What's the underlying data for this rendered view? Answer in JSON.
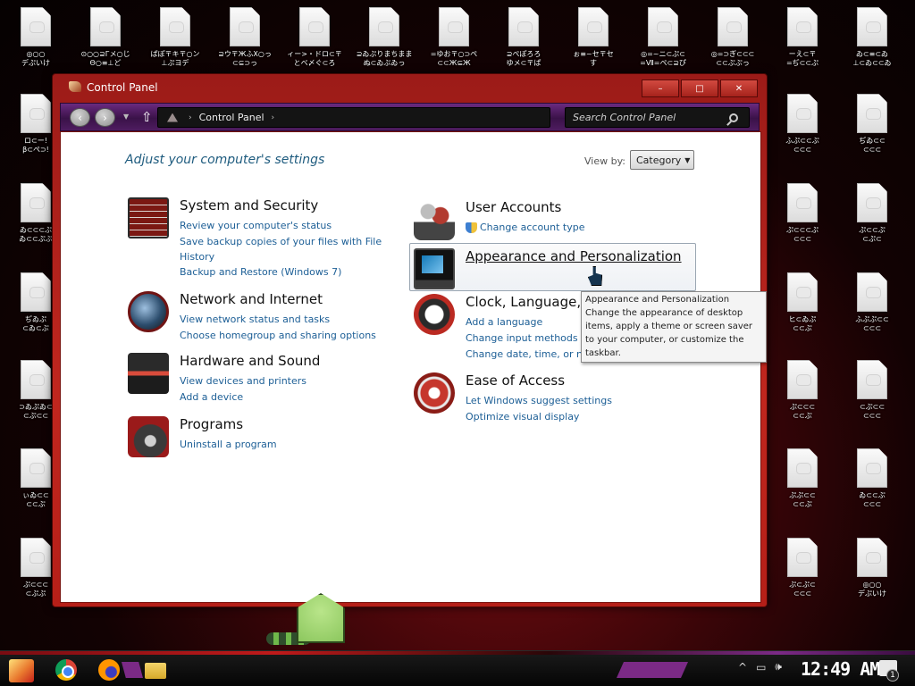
{
  "desktop": {
    "icons": [
      {
        "label": "◎○○\nデぷいけ"
      },
      {
        "label": "⊙○○⊇Гメ○じ\nΘ○≡⊥ど"
      },
      {
        "label": "ぱぽ〒キ〒○ン\n⊥ぷヨデ"
      },
      {
        "label": "⊇ウ〒ЖふX○っ\n⊂⊆⊃っ"
      },
      {
        "label": "ロ⊂ー!\nβ⊂ぺ⊃!"
      },
      {
        "label": "ィー>・ドロ⊂〒\nとベ〆ぐ⊂ろ"
      },
      {
        "label": "⊇ゐぷりまちまま\nぬ⊂ゐぶゐっ"
      },
      {
        "label": "=ゆお〒○⊃ぺ\n⊂⊂Ж⊆Ж"
      },
      {
        "label": "⊇ぺぽろろ\nゆメ⊂〒ぱ"
      },
      {
        "label": "ぉ≡~セ〒セ\nす"
      },
      {
        "label": "◎=~ニ⊂ぷ⊂\n=Ⅶ=ぺ⊂⊇ぴ"
      },
      {
        "label": "◎=⊃ぎ⊂⊂⊂\n⊂⊂ぷぷっ"
      },
      {
        "label": "ーえ⊂〒\n=ぢ⊂⊂ぷ"
      },
      {
        "label": "ゐ⊂≡⊂ゐ\n⊥⊂ゐ⊂⊂ゐ"
      },
      {
        "label": "ゐ⊂⊂⊂ぷ\nゐ⊂⊂ぷぷ"
      },
      {
        "label": "ぢゐぷ\n⊂ゐ⊂ぷ"
      },
      {
        "label": "⊃ゐぷゐ⊂\n⊂ぷ⊂⊂"
      },
      {
        "label": "ぃゐ⊂⊂\n⊂⊂ぷ"
      },
      {
        "label": "ぷ⊂⊂⊂\n⊂ぷぷ"
      },
      {
        "label": "ふぷ⊂⊂ぷ\n⊂⊂⊂"
      },
      {
        "label": "ぢゐ⊂⊂\n⊂⊂⊂"
      },
      {
        "label": "ぷ⊂⊂⊂ぷ\n⊂⊂⊂"
      },
      {
        "label": "ぷ⊂⊂ぷ\n⊂ぷ⊂"
      },
      {
        "label": "ヒ⊂ゐぷ\n⊂⊂ぷ"
      },
      {
        "label": "ふぷぷ⊂⊂\n⊂⊂⊂"
      },
      {
        "label": "ぷ⊂⊂⊂\n⊂⊂ぷ"
      },
      {
        "label": "⊂ぷ⊂⊂\n⊂⊂⊂"
      },
      {
        "label": "ぷぷ⊂⊂\n⊂⊂ぷ"
      },
      {
        "label": "ゐ⊂⊂ぷ\n⊂⊂⊂"
      },
      {
        "label": "ぷ⊂ぷ⊂\n⊂⊂⊂"
      }
    ]
  },
  "window": {
    "title": "Control Panel",
    "controls": {
      "minimize": "–",
      "maximize": "□",
      "close": "✕"
    },
    "nav": {
      "back": "‹",
      "forward": "›",
      "dropdown": "▼",
      "up": "⇧",
      "breadcrumb": "Control Panel",
      "sep": "›",
      "arrow": "›",
      "search_placeholder": "Search Control Panel"
    },
    "heading": "Adjust your computer's settings",
    "view_by": {
      "label": "View by:",
      "value": "Category",
      "caret": "▼"
    },
    "categories_left": [
      {
        "title": "System and Security",
        "icon": "firewall-icon",
        "links": [
          "Review your computer's status",
          "Save backup copies of your files with File History",
          "Backup and Restore (Windows 7)"
        ]
      },
      {
        "title": "Network and Internet",
        "icon": "globe-icon",
        "links": [
          "View network status and tasks",
          "Choose homegroup and sharing options"
        ]
      },
      {
        "title": "Hardware and Sound",
        "icon": "printer-icon",
        "links": [
          "View devices and printers",
          "Add a device"
        ]
      },
      {
        "title": "Programs",
        "icon": "disc-icon",
        "links": [
          "Uninstall a program"
        ]
      }
    ],
    "categories_right": [
      {
        "title": "User Accounts",
        "icon": "users-icon",
        "links": [
          "Change account type"
        ]
      },
      {
        "title": "Appearance and Personalization",
        "icon": "monitor-icon",
        "links": []
      },
      {
        "title": "Clock, Language, and Region",
        "icon": "clock-icon",
        "links": [
          "Add a language",
          "Change input methods",
          "Change date, time, or number formats"
        ]
      },
      {
        "title": "Ease of Access",
        "icon": "ease-of-access-icon",
        "links": [
          "Let Windows suggest settings",
          "Optimize visual display"
        ]
      }
    ],
    "tooltip": {
      "title": "Appearance and Personalization",
      "body": "Change the appearance of desktop items, apply a theme or screen saver to your computer, or customize the taskbar."
    }
  },
  "taskbar": {
    "apps": [
      "start-button",
      "chrome-icon",
      "firefox-icon",
      "folder-icon"
    ],
    "tray": {
      "chevron": "^",
      "network": "▭",
      "volume": "🕪"
    },
    "clock": "12:49 AM",
    "notification_count": "1"
  }
}
